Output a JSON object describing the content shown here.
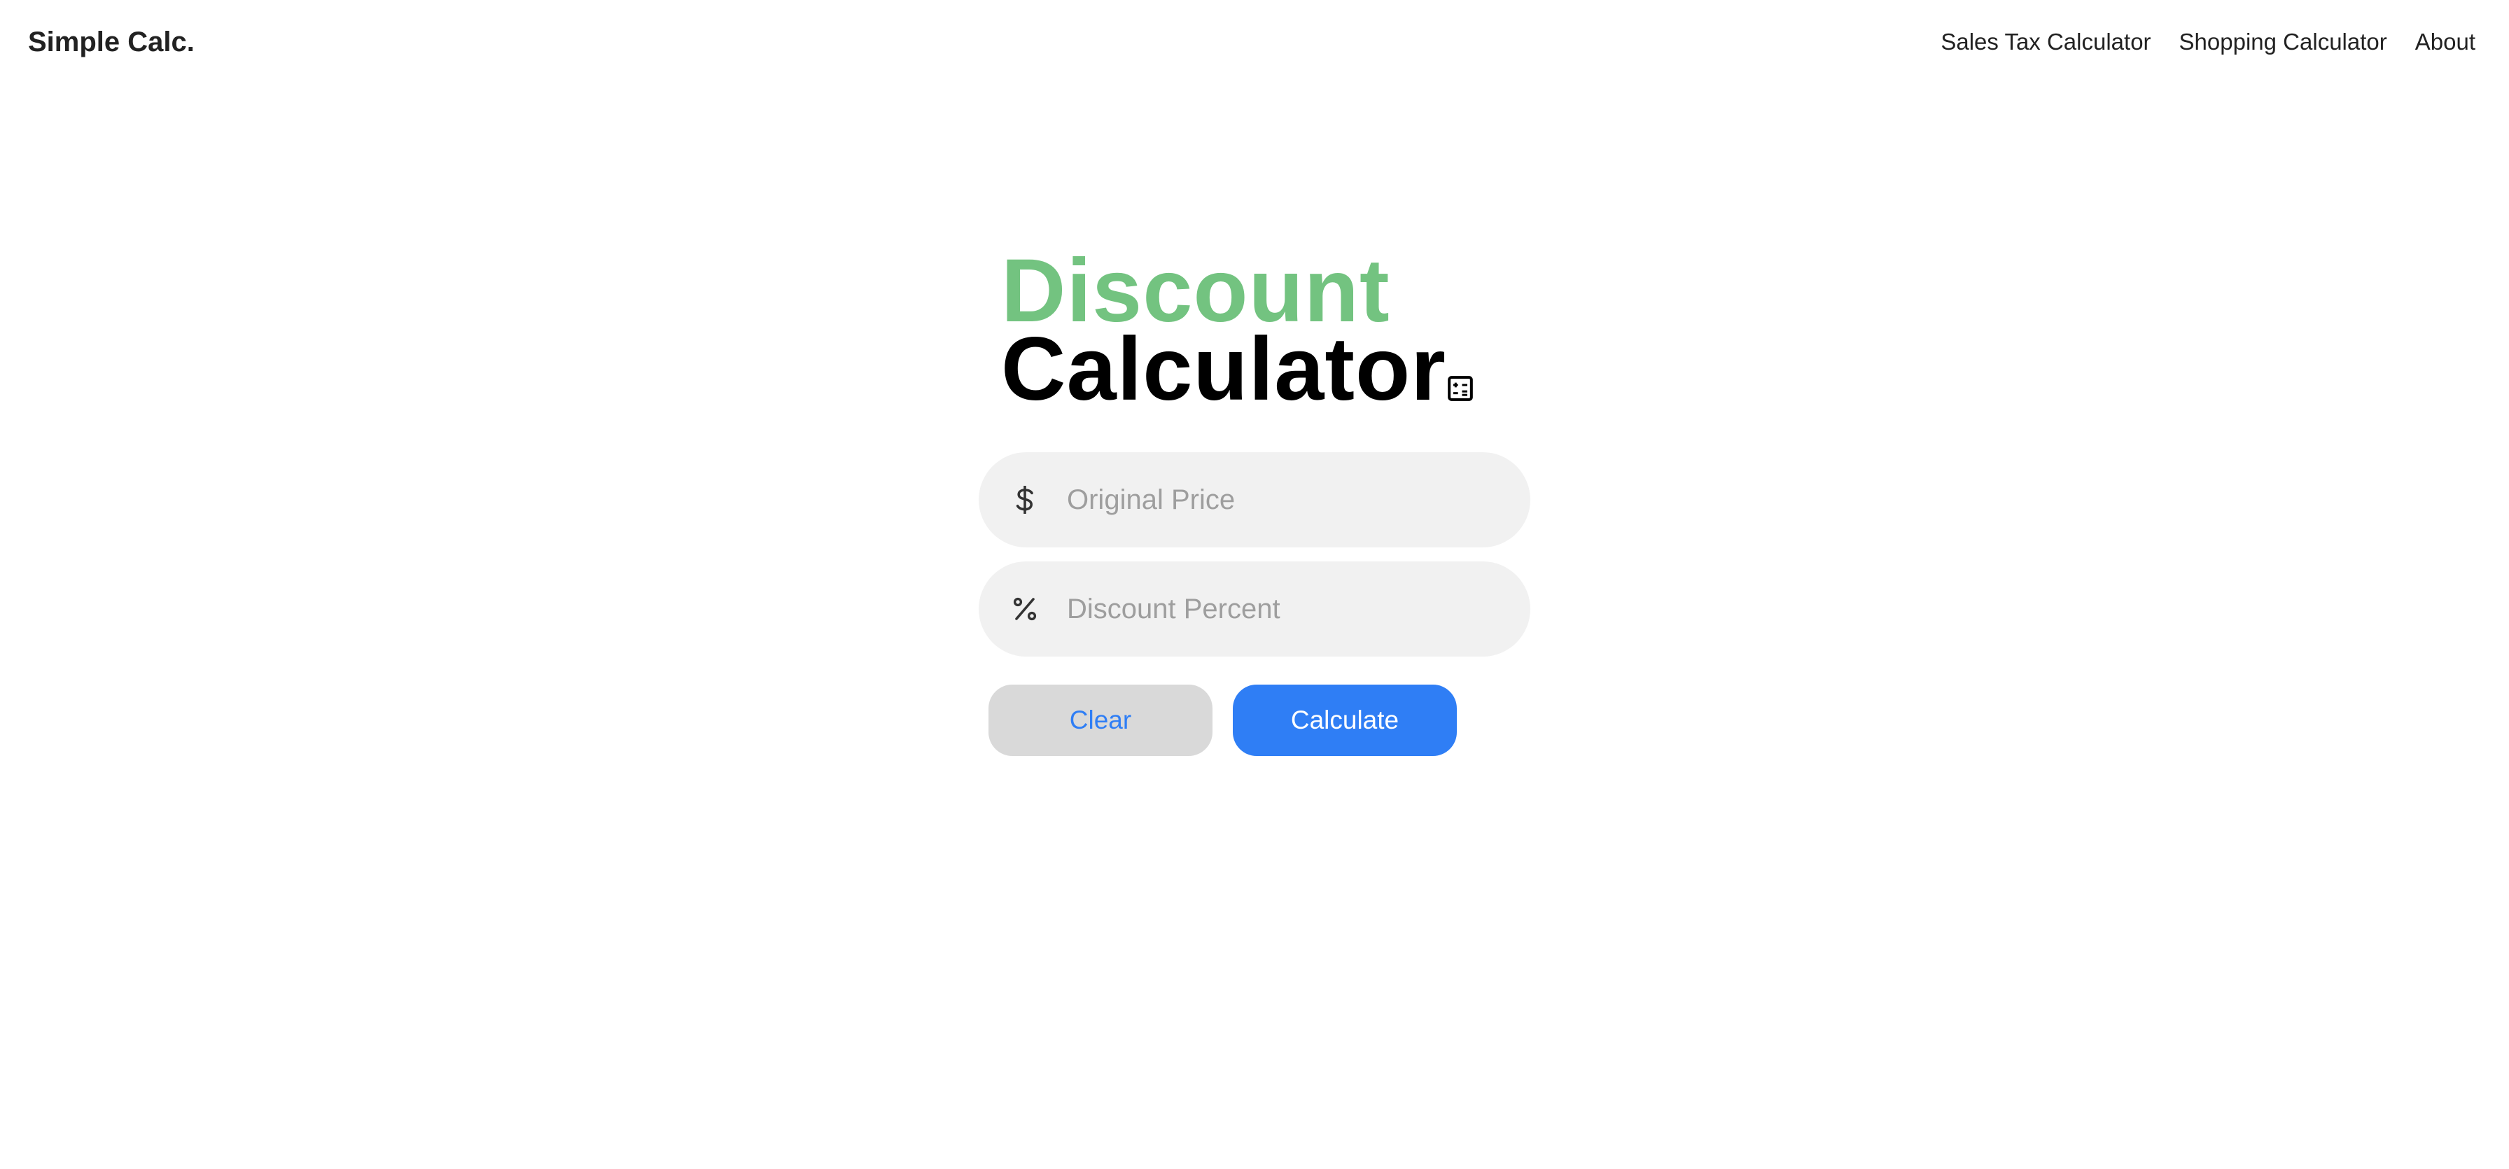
{
  "header": {
    "brand": "Simple Calc.",
    "nav": [
      {
        "label": "Sales Tax Calculator"
      },
      {
        "label": "Shopping Calculator"
      },
      {
        "label": "About"
      }
    ]
  },
  "hero": {
    "title_line1": "Discount",
    "title_line2": "Calculator",
    "title_icon": "calculator-icon"
  },
  "form": {
    "price": {
      "icon": "dollar-icon",
      "placeholder": "Original Price",
      "value": ""
    },
    "percent": {
      "icon": "percent-icon",
      "placeholder": "Discount Percent",
      "value": ""
    }
  },
  "actions": {
    "clear_label": "Clear",
    "calculate_label": "Calculate"
  },
  "colors": {
    "accent_green": "#73c380",
    "primary_blue": "#2f7ef5",
    "input_bg": "#f1f1f1",
    "clear_bg": "#d9d9d9"
  }
}
